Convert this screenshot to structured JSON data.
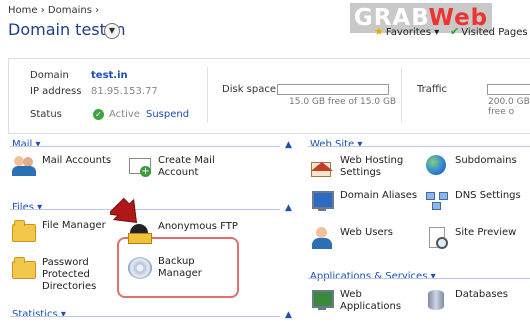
{
  "header": {
    "breadcrumb": {
      "home": "Home",
      "sep": "›",
      "domains": "Domains",
      "sep2": "›"
    },
    "title": "Domain test.in",
    "favorites": "Favorites",
    "visited_pages": "Visited Pages",
    "watermark_a": "GRAB",
    "watermark_b": "Web"
  },
  "info": {
    "domain_label": "Domain",
    "domain_value": "test.in",
    "ip_label": "IP address",
    "ip_value": "81.95.153.77",
    "status_label": "Status",
    "status_value": "Active",
    "suspend_label": "Suspend",
    "disk_label": "Disk space",
    "disk_caption": "15.0 GB free of 15.0 GB",
    "disk_used_fraction": 0.0,
    "traffic_label": "Traffic",
    "traffic_caption": "200.0 GB free o",
    "traffic_used_fraction": 0.0
  },
  "sections": {
    "mail": {
      "title": "Mail",
      "items": {
        "mail_accounts": "Mail Accounts",
        "create_mail_1": "Create Mail",
        "create_mail_2": "Account"
      }
    },
    "files": {
      "title": "Files",
      "items": {
        "file_manager": "File Manager",
        "anonymous_ftp": "Anonymous FTP",
        "password_1": "Password",
        "password_2": "Protected",
        "password_3": "Directories",
        "backup_manager": "Backup Manager"
      }
    },
    "statistics": {
      "title": "Statistics"
    },
    "website": {
      "title": "Web Site",
      "items": {
        "web_hosting_1": "Web Hosting",
        "web_hosting_2": "Settings",
        "subdomains": "Subdomains",
        "domain_aliases": "Domain Aliases",
        "dns_settings": "DNS Settings",
        "web_users": "Web Users",
        "site_preview": "Site Preview"
      }
    },
    "apps": {
      "title": "Applications & Services",
      "items": {
        "web_applications": "Web Applications",
        "databases": "Databases"
      }
    }
  },
  "colors": {
    "link": "#1a4fb4",
    "highlight": "#e07070",
    "arrow": "#b01818"
  }
}
